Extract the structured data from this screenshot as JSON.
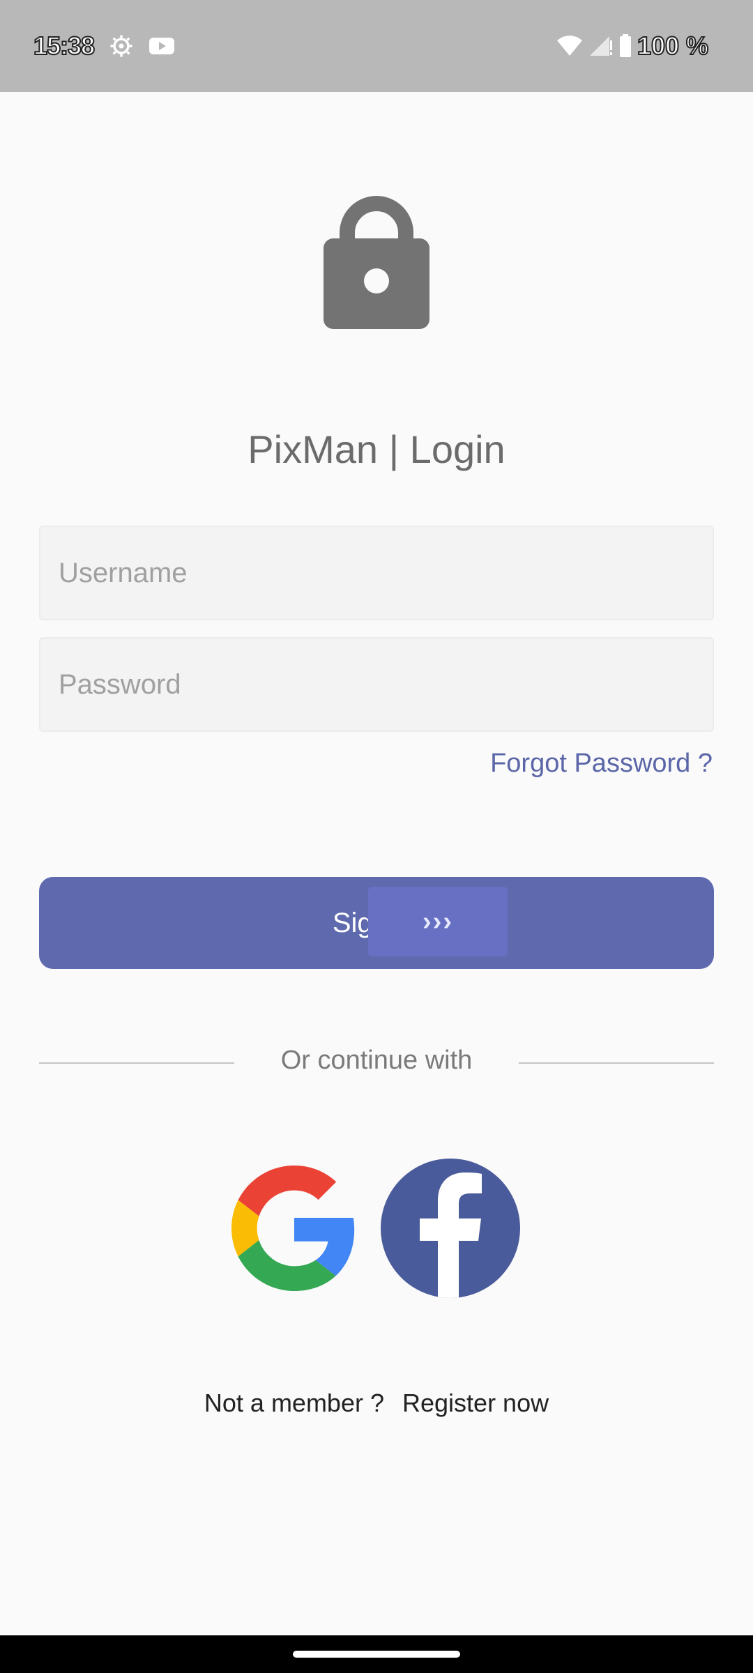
{
  "status_bar": {
    "time": "15:38",
    "battery": "100 %",
    "icons": [
      "settings-gear-icon",
      "youtube-icon",
      "wifi-icon",
      "signal-icon",
      "battery-icon"
    ]
  },
  "header": {
    "icon": "lock-icon",
    "title": "PixMan | Login"
  },
  "form": {
    "username_placeholder": "Username",
    "password_placeholder": "Password",
    "forgot_label": "Forgot Password ?",
    "signin_label": "Sign in",
    "signin_arrows": "›››"
  },
  "social": {
    "divider_text": "Or continue with",
    "providers": [
      "google-icon",
      "facebook-icon"
    ]
  },
  "register": {
    "prompt": "Not a member ?",
    "link": "Register now"
  },
  "colors": {
    "accent": "#5f6aae",
    "link": "#5b66a8",
    "status_bar": "#b8b8b8",
    "background": "#fafafa"
  }
}
